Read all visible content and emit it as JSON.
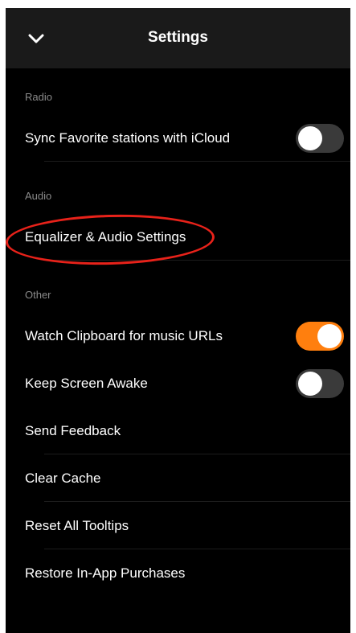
{
  "header": {
    "title": "Settings",
    "back_icon": "chevron-down-icon"
  },
  "colors": {
    "accent": "#ff7f0e",
    "annotation": "#e8221a",
    "background": "#000000",
    "navbar": "#1a1a1a"
  },
  "sections": {
    "radio": {
      "header": "Radio",
      "sync_icloud": {
        "label": "Sync Favorite stations with iCloud",
        "enabled": false
      }
    },
    "audio": {
      "header": "Audio",
      "equalizer": {
        "label": "Equalizer & Audio Settings"
      }
    },
    "other": {
      "header": "Other",
      "watch_clipboard": {
        "label": "Watch Clipboard for music URLs",
        "enabled": true
      },
      "keep_awake": {
        "label": "Keep Screen Awake",
        "enabled": false
      },
      "send_feedback": {
        "label": "Send Feedback"
      },
      "clear_cache": {
        "label": "Clear Cache"
      },
      "reset_tooltips": {
        "label": "Reset All Tooltips"
      },
      "restore_purchases": {
        "label": "Restore In-App Purchases"
      }
    }
  }
}
